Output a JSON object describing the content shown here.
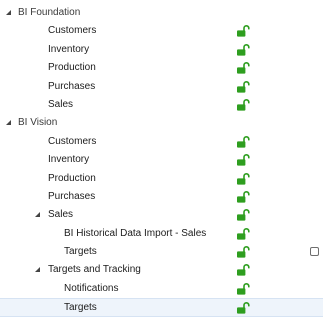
{
  "tree": [
    {
      "label": "BI Foundation",
      "depth": 0,
      "has_toggle": true,
      "expanded": true,
      "lock": false
    },
    {
      "label": "Customers",
      "depth": 1,
      "has_toggle": false,
      "lock": true
    },
    {
      "label": "Inventory",
      "depth": 1,
      "has_toggle": false,
      "lock": true
    },
    {
      "label": "Production",
      "depth": 1,
      "has_toggle": false,
      "lock": true
    },
    {
      "label": "Purchases",
      "depth": 1,
      "has_toggle": false,
      "lock": true
    },
    {
      "label": "Sales",
      "depth": 1,
      "has_toggle": false,
      "lock": true
    },
    {
      "label": "BI Vision",
      "depth": 0,
      "has_toggle": true,
      "expanded": true,
      "lock": false
    },
    {
      "label": "Customers",
      "depth": 1,
      "has_toggle": false,
      "lock": true
    },
    {
      "label": "Inventory",
      "depth": 1,
      "has_toggle": false,
      "lock": true
    },
    {
      "label": "Production",
      "depth": 1,
      "has_toggle": false,
      "lock": true
    },
    {
      "label": "Purchases",
      "depth": 1,
      "has_toggle": false,
      "lock": true
    },
    {
      "label": "Sales",
      "depth": 1,
      "has_toggle": true,
      "expanded": true,
      "lock": true
    },
    {
      "label": "BI Historical Data Import - Sales",
      "depth": 2,
      "has_toggle": false,
      "lock": true
    },
    {
      "label": "Targets",
      "depth": 2,
      "has_toggle": false,
      "lock": true,
      "checkbox": true
    },
    {
      "label": "Targets and Tracking",
      "depth": 1,
      "has_toggle": true,
      "expanded": true,
      "lock": true
    },
    {
      "label": "Notifications",
      "depth": 2,
      "has_toggle": false,
      "lock": true
    },
    {
      "label": "Targets",
      "depth": 2,
      "has_toggle": false,
      "lock": true,
      "selected": true
    }
  ],
  "colors": {
    "lock": "#2e9e1f",
    "selected_bg": "#eef4fb"
  },
  "icons": {
    "lock": "unlocked-padlock-icon",
    "toggle": "expanded-triangle-icon"
  }
}
